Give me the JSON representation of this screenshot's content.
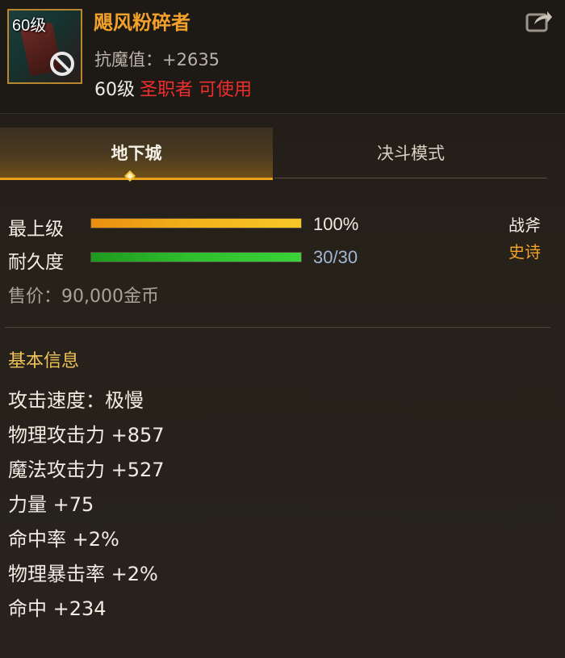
{
  "item": {
    "level_tag": "60级",
    "name": "飓风粉碎者",
    "anti_magic": "抗魔值：+2635",
    "req_level": "60级",
    "req_class": "圣职者 可使用",
    "icon": "axe-weapon-icon",
    "restricted_icon": "no-entry-icon"
  },
  "tabs": [
    {
      "label": "地下城",
      "active": true
    },
    {
      "label": "决斗模式",
      "active": false
    }
  ],
  "bars": {
    "grade": {
      "label": "最上级",
      "value_text": "100%",
      "value": 1.0
    },
    "durability": {
      "label": "耐久度",
      "value_text": "30/30",
      "value": 1.0
    }
  },
  "weapon_type": "战斧",
  "rarity": "史诗",
  "price": "售价：90,000金币",
  "basic_info": {
    "title": "基本信息",
    "stats": [
      "攻击速度：极慢",
      "物理攻击力 +857",
      "魔法攻击力 +527",
      "力量 +75",
      "命中率 +2%",
      "物理暴击率 +2%",
      "命中 +234"
    ]
  },
  "colors": {
    "name": "#f3a12a",
    "class_req": "#ee2d2d",
    "durability_text": "#9fb6d6",
    "gold_bar": "#f2b31a",
    "green_bar": "#2fc12f",
    "tab_accent": "#e9a21c"
  }
}
